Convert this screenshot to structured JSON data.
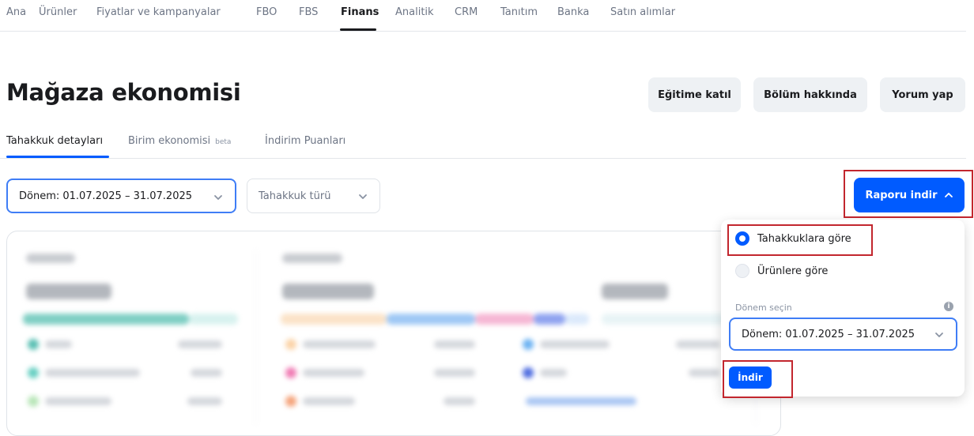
{
  "nav": {
    "items": [
      {
        "label": "Ana"
      },
      {
        "label": "Ürünler"
      },
      {
        "label": "Fiyatlar ve kampanyalar"
      },
      {
        "label": "FBO"
      },
      {
        "label": "FBS"
      },
      {
        "label": "Finans",
        "active": true
      },
      {
        "label": "Analitik"
      },
      {
        "label": "CRM"
      },
      {
        "label": "Tanıtım"
      },
      {
        "label": "Banka"
      },
      {
        "label": "Satın alımlar"
      }
    ]
  },
  "page": {
    "title": "Mağaza ekonomisi"
  },
  "header_buttons": {
    "training": "Eğitime katıl",
    "about": "Bölüm hakkında",
    "feedback": "Yorum yap"
  },
  "subtabs": {
    "accrual_details": "Tahakkuk detayları",
    "unit_economics": "Birim ekonomisi",
    "beta_badge": "beta",
    "discount_points": "İndirim Puanları"
  },
  "filters": {
    "period": "Dönem: 01.07.2025 – 31.07.2025",
    "accrual_type": "Tahakkuk türü"
  },
  "report": {
    "download_button": "Raporu indir",
    "options": [
      {
        "label": "Tahakkuklara göre",
        "selected": true
      },
      {
        "label": "Ürünlere göre",
        "selected": false
      }
    ],
    "period_label": "Dönem seçin",
    "period_value": "Dönem: 01.07.2025 – 31.07.2025",
    "submit_button": "İndir"
  },
  "colors": {
    "accent": "#005bff",
    "highlight_box": "#c2262e"
  }
}
